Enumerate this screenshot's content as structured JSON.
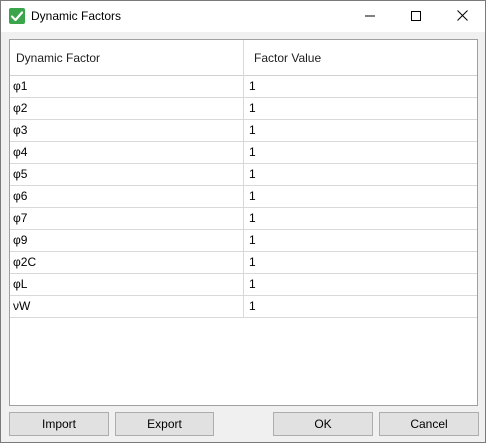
{
  "window": {
    "title": "Dynamic Factors",
    "icon": "check-icon",
    "controls": [
      "minimize-icon",
      "maximize-icon",
      "close-icon"
    ]
  },
  "table": {
    "columns": [
      "Dynamic Factor",
      "Factor Value"
    ],
    "rows": [
      {
        "factor": "φ1",
        "value": "1"
      },
      {
        "factor": "φ2",
        "value": "1"
      },
      {
        "factor": "φ3",
        "value": "1"
      },
      {
        "factor": "φ4",
        "value": "1"
      },
      {
        "factor": "φ5",
        "value": "1"
      },
      {
        "factor": "φ6",
        "value": "1"
      },
      {
        "factor": "φ7",
        "value": "1"
      },
      {
        "factor": "φ9",
        "value": "1"
      },
      {
        "factor": "φ2C",
        "value": "1"
      },
      {
        "factor": "φL",
        "value": "1"
      },
      {
        "factor": "νW",
        "value": "1"
      }
    ]
  },
  "buttons": {
    "import": "Import",
    "export": "Export",
    "ok": "OK",
    "cancel": "Cancel"
  },
  "colors": {
    "icon_green": "#3aa54a",
    "grid_line": "#d9d9d9",
    "button_face": "#e1e1e1"
  }
}
